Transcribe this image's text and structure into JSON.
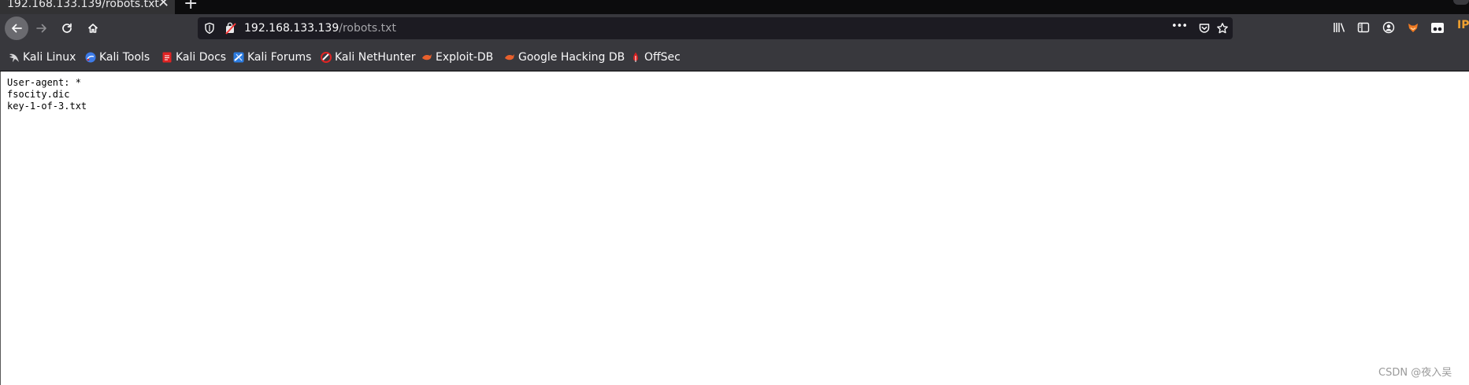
{
  "browser": {
    "tab": {
      "title": "192.168.133.139/robots.txt",
      "close_glyph": "✕"
    },
    "new_tab_glyph": "+",
    "url": {
      "host": "192.168.133.139",
      "path": "/robots.txt"
    },
    "url_more_glyph": "•••",
    "icons": {
      "back": "arrow-left-icon",
      "forward": "arrow-right-icon",
      "reload": "reload-icon",
      "home": "home-icon",
      "shield": "tracking-shield-icon",
      "page_actions": "more-icon",
      "pocket": "pocket-icon",
      "bookmark_star": "star-icon",
      "library": "library-icon",
      "sidebar": "sidebar-icon",
      "account": "account-icon",
      "extension_fox": "fox-extension-icon",
      "extension_eyes": "eyes-extension-icon",
      "extension_ip": "ip-extension-icon"
    },
    "extension_ip_label": "IP"
  },
  "bookmarks": [
    {
      "label": "Kali Linux",
      "icon": "kali-dragon-icon",
      "color": "#e8e8e8"
    },
    {
      "label": "Kali Tools",
      "icon": "kali-tools-icon",
      "color": "#3d7be8"
    },
    {
      "label": "Kali Docs",
      "icon": "kali-docs-icon",
      "color": "#e02424"
    },
    {
      "label": "Kali Forums",
      "icon": "kali-forums-icon",
      "color": "#2b7be0"
    },
    {
      "label": "Kali NetHunter",
      "icon": "nethunter-icon",
      "color": "#e02424"
    },
    {
      "label": "Exploit-DB",
      "icon": "exploit-db-icon",
      "color": "#e8602c"
    },
    {
      "label": "Google Hacking DB",
      "icon": "ghdb-icon",
      "color": "#e8602c"
    },
    {
      "label": "OffSec",
      "icon": "offsec-icon",
      "color": "#d82020"
    }
  ],
  "page": {
    "lines": [
      "User-agent: *",
      "fsocity.dic",
      "key-1-of-3.txt"
    ]
  },
  "watermark": "CSDN @夜入吴",
  "colors": {
    "titlebar": "#0c0c0d",
    "toolbar": "#38383d",
    "urlbar": "#1c1b22",
    "page_bg": "#ffffff"
  }
}
